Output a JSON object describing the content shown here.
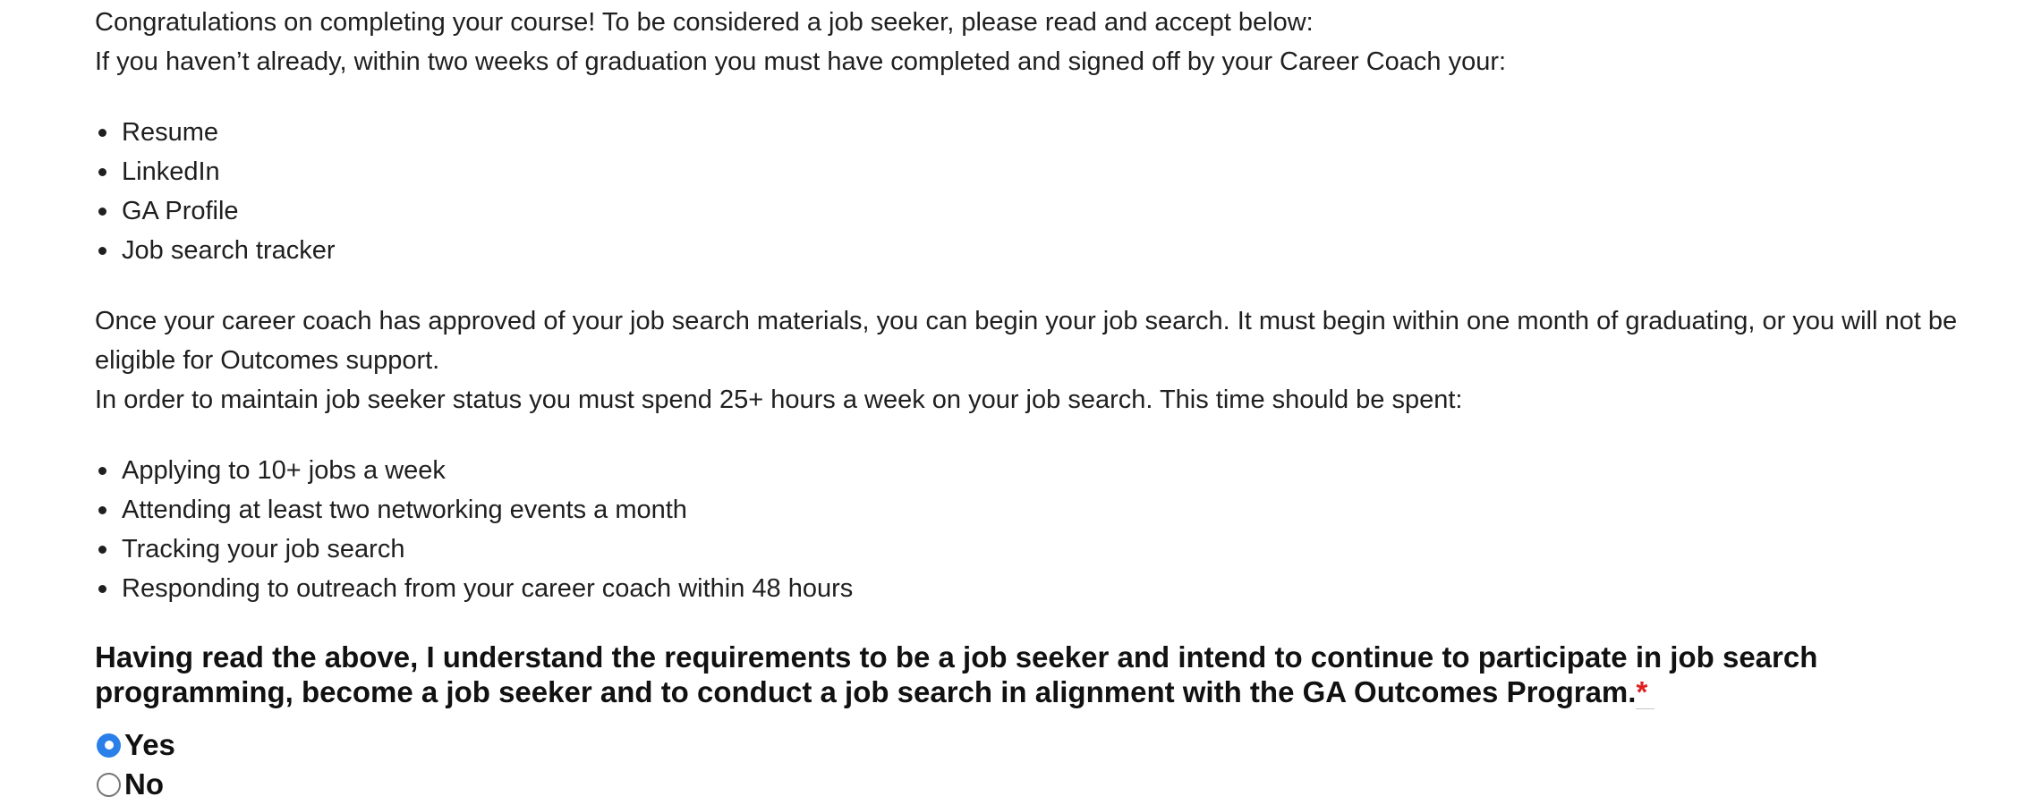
{
  "intro": {
    "line1": "Congratulations on completing your course! To be considered a job seeker, please read and accept below:",
    "line2": "If you haven’t already, within two weeks of graduation you must have completed and signed off by your Career Coach your:"
  },
  "materials_list": [
    "Resume",
    "LinkedIn",
    "GA Profile",
    "Job search tracker"
  ],
  "job_search": {
    "paragraph": "Once your career coach has approved of your job search materials, you can begin your job search. It must begin within one month of graduating, or you will not be eligible for Outcomes support.",
    "status_line": "In order to maintain job seeker status you must spend 25+ hours a week on your job search. This time should be spent:"
  },
  "activities_list": [
    "Applying to 10+ jobs a week",
    "Attending at least two networking events a month",
    "Tracking your job search",
    "Responding to outreach from your career coach within 48 hours"
  ],
  "question": {
    "text": "Having read the above, I understand the requirements to be a job seeker and intend to continue to participate in job search programming, become a job seeker and to conduct a job search in alignment with the GA Outcomes Program.",
    "required_marker": "*"
  },
  "options": [
    {
      "label": "Yes",
      "selected": true
    },
    {
      "label": "No",
      "selected": false
    }
  ],
  "colors": {
    "accent": "#2b7fe8",
    "required": "#e02020",
    "text": "#1f1f1f"
  }
}
